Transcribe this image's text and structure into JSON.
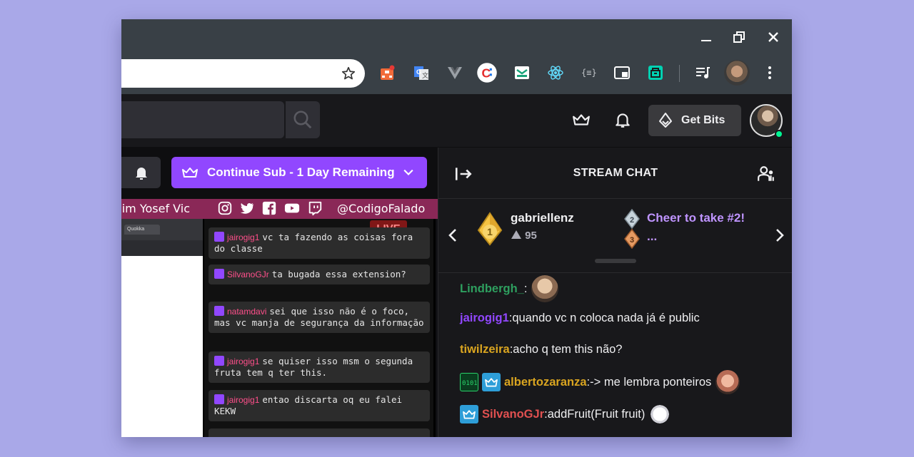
{
  "toolbar": {
    "extensions": [
      "org-chart-icon",
      "google-translate-icon",
      "vue-devtools-icon",
      "clockify-icon",
      "mail-extension-icon",
      "react-devtools-icon",
      "json-formatter-icon",
      "picture-in-picture-icon",
      "archive-extension-icon",
      "media-playlist-icon",
      "profile-avatar",
      "kebab-menu-icon"
    ]
  },
  "topnav": {
    "get_bits_label": "Get Bits"
  },
  "channel": {
    "sub_button_label": "Continue Sub - 1 Day Remaining",
    "banner_names": "Jim Yosef  Vic",
    "banner_handle": "@CodigoFalado",
    "live_label": "LIVE",
    "mini_tab_label": "Quokka",
    "overlay_messages": [
      {
        "user": "jairogig1",
        "text": "vc ta fazendo as coisas fora do classe"
      },
      {
        "user": "SilvanoGJr",
        "text": "ta bugada essa extension?"
      },
      {
        "user": "natamdavi",
        "text": "sei que isso não é o foco, mas vc manja de segurança da informação"
      },
      {
        "user": "jairogig1",
        "text": "se quiser isso msm o segunda fruta tem q ter this."
      },
      {
        "user": "jairogig1",
        "text": "entao discarta oq eu falei KEKW"
      }
    ]
  },
  "chat": {
    "title": "STREAM CHAT",
    "leaderboard": {
      "top_user": "gabriellenz",
      "top_rank": "1",
      "top_score": "95",
      "cheer_cta": "Cheer to take #2!",
      "rank2": "2",
      "rank3": "3",
      "third_user": "..."
    },
    "messages": [
      {
        "user": "Lindbergh_",
        "sep": ":",
        "text": "",
        "color": "#2e9f5f"
      },
      {
        "user": "jairogig1",
        "sep": ":",
        "text": " quando vc n coloca nada já é public",
        "color": "#9147ff"
      },
      {
        "user": "tiwilzeira",
        "sep": ":",
        "text": " acho q tem this não?",
        "color": "#daa520"
      },
      {
        "user": "albertozaranza",
        "sep": ":",
        "text": " -> me lembra ponteiros",
        "color": "#daa520"
      },
      {
        "user": "SilvanoGJr",
        "sep": ":",
        "text": " addFruit(Fruit fruit)",
        "color": "#e05050"
      }
    ]
  }
}
